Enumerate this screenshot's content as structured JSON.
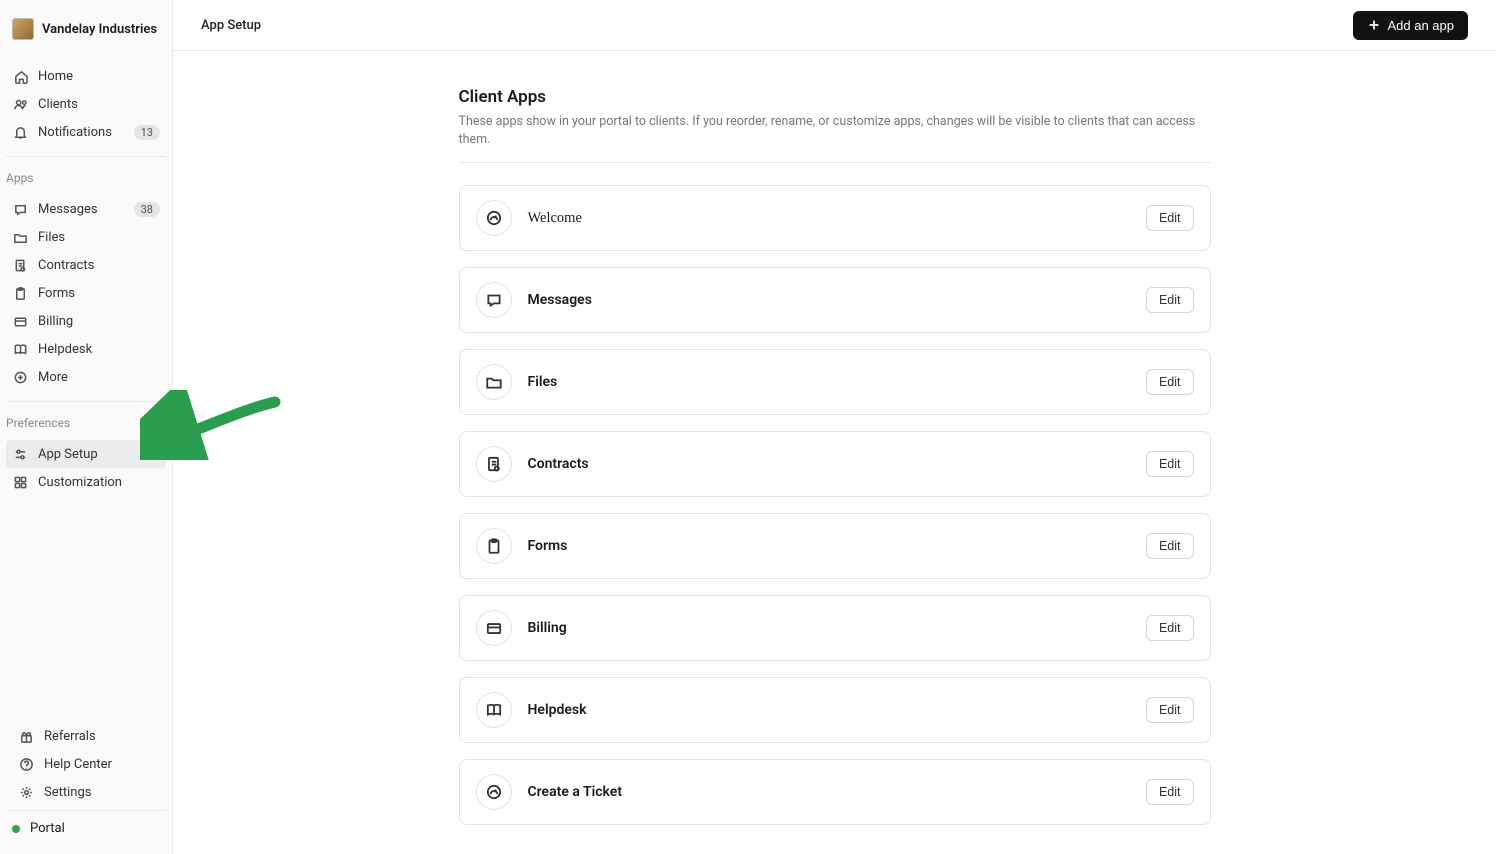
{
  "org": {
    "name": "Vandelay Industries"
  },
  "sidebar": {
    "main": [
      {
        "label": "Home",
        "icon": "home"
      },
      {
        "label": "Clients",
        "icon": "users"
      },
      {
        "label": "Notifications",
        "icon": "bell",
        "badge": "13"
      }
    ],
    "apps_heading": "Apps",
    "apps": [
      {
        "label": "Messages",
        "icon": "message",
        "badge": "38"
      },
      {
        "label": "Files",
        "icon": "folder"
      },
      {
        "label": "Contracts",
        "icon": "contract"
      },
      {
        "label": "Forms",
        "icon": "clipboard"
      },
      {
        "label": "Billing",
        "icon": "card"
      },
      {
        "label": "Helpdesk",
        "icon": "book"
      },
      {
        "label": "More",
        "icon": "more"
      }
    ],
    "prefs_heading": "Preferences",
    "prefs": [
      {
        "label": "App Setup",
        "icon": "sliders",
        "active": true
      },
      {
        "label": "Customization",
        "icon": "grid"
      }
    ],
    "footer": [
      {
        "label": "Referrals",
        "icon": "gift"
      },
      {
        "label": "Help Center",
        "icon": "help"
      },
      {
        "label": "Settings",
        "icon": "gear"
      }
    ],
    "portal_label": "Portal"
  },
  "topbar": {
    "breadcrumb": "App Setup",
    "add_button": "Add an app"
  },
  "page": {
    "title": "Client Apps",
    "description": "These apps show in your portal to clients. If you reorder, rename, or customize apps, changes will be visible to clients that can access them.",
    "edit_label": "Edit",
    "apps": [
      {
        "name": "Welcome",
        "icon": "dashboard",
        "serif": true
      },
      {
        "name": "Messages",
        "icon": "message"
      },
      {
        "name": "Files",
        "icon": "folder"
      },
      {
        "name": "Contracts",
        "icon": "contract"
      },
      {
        "name": "Forms",
        "icon": "clipboard"
      },
      {
        "name": "Billing",
        "icon": "card"
      },
      {
        "name": "Helpdesk",
        "icon": "book"
      },
      {
        "name": "Create a Ticket",
        "icon": "dashboard"
      }
    ]
  }
}
